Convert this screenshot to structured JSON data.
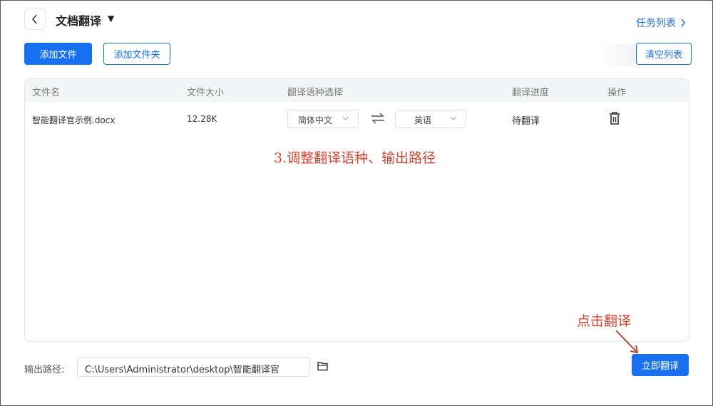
{
  "header": {
    "title": "文档翻译",
    "task_list_label": "任务列表"
  },
  "toolbar": {
    "add_file_label": "添加文件",
    "add_folder_label": "添加文件夹",
    "clear_list_label": "清空列表"
  },
  "table": {
    "columns": {
      "filename": "文件名",
      "filesize": "文件大小",
      "language": "翻译语种选择",
      "progress": "翻译进度",
      "action": "操作"
    },
    "rows": [
      {
        "filename": "智能翻译官示例.docx",
        "filesize": "12.28K",
        "source_lang": "简体中文",
        "target_lang": "英语",
        "status": "待翻译"
      }
    ]
  },
  "annotations": {
    "step3": "3.调整翻译语种、输出路径",
    "click_translate": "点击翻译"
  },
  "output": {
    "label": "输出路径:",
    "path": "C:\\Users\\Administrator\\desktop\\智能翻译官"
  },
  "footer": {
    "translate_now_label": "立即翻译"
  },
  "colors": {
    "accent": "#1670f0",
    "annotation": "#d8432f"
  },
  "icons": [
    "back-icon",
    "caret-down-icon",
    "chevron-right-icon",
    "chevron-down-icon",
    "swap-icon",
    "trash-icon",
    "folder-icon",
    "arrow-icon"
  ]
}
